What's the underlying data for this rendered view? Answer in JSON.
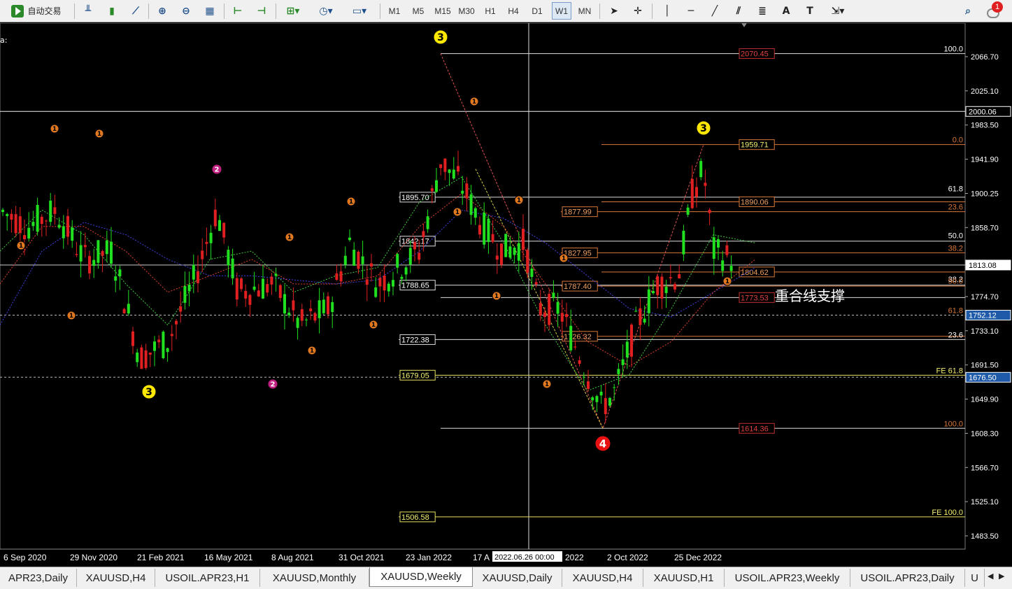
{
  "toolbar": {
    "auto_trade_label": "自动交易",
    "timeframes": [
      "M1",
      "M5",
      "M15",
      "M30",
      "H1",
      "H4",
      "D1",
      "W1",
      "MN"
    ],
    "active_timeframe": "W1",
    "notification_count": "1"
  },
  "chart": {
    "symbol_fragment": "a:",
    "crosshair_time": "2022.06.26 00:00",
    "annotation_text": "重合线支撑",
    "price_axis": [
      "2066.70",
      "2025.10",
      "1983.50",
      "1941.90",
      "1900.25",
      "1858.70",
      "1774.70",
      "1733.10",
      "1691.50",
      "1649.90",
      "1608.30",
      "1566.70",
      "1525.10",
      "1483.50"
    ],
    "price_axis_highlights": [
      {
        "label": "2000.06",
        "color": "#ffffff",
        "bg": "#000000",
        "text": "#ffffff"
      },
      {
        "label": "1813.08",
        "color": "#ffffff",
        "bg": "#ffffff",
        "text": "#000000"
      },
      {
        "label": "1752.12",
        "color": "#ffffff",
        "bg": "#1e5aa8",
        "text": "#ffffff"
      },
      {
        "label": "1676.50",
        "color": "#ffffff",
        "bg": "#1e5aa8",
        "text": "#ffffff"
      }
    ],
    "time_axis": [
      "6 Sep 2020",
      "29 Nov 2020",
      "21 Feb 2021",
      "16 May 2021",
      "8 Aug 2021",
      "31 Oct 2021",
      "23 Jan 2022",
      "17 A",
      "2022",
      "2 Oct 2022",
      "25 Dec 2022"
    ],
    "level_labels_white": [
      "1895.70",
      "1842.17",
      "1788.65",
      "1722.38"
    ],
    "level_labels_yellow": [
      "1679.05",
      "1506.58"
    ],
    "level_labels_orange": [
      "1877.99",
      "1827.95",
      "1787.40",
      "1726.32"
    ],
    "fib_right_labels": [
      "1959.71",
      "1890.06",
      "1804.62"
    ],
    "fib_red_labels": [
      "2070.45",
      "1773.53",
      "1614.36"
    ],
    "fib_pct_labels": [
      "100.0",
      "0.0",
      "61.8",
      "23.6",
      "50.0",
      "38.2",
      "38.2",
      "50.0",
      "61.8",
      "23.6",
      "FE 61.8",
      "100.0",
      "FE 100.0"
    ],
    "wave_labels": [
      {
        "text": "3",
        "kind": "yellow"
      },
      {
        "text": "3",
        "kind": "yellow"
      },
      {
        "text": "3",
        "kind": "yellow"
      },
      {
        "text": "4",
        "kind": "red"
      },
      {
        "text": "2",
        "kind": "magenta"
      },
      {
        "text": "2",
        "kind": "magenta"
      }
    ],
    "minor_wave_label": "1"
  },
  "tabs": [
    "APR23,Daily",
    "XAUUSD,H4",
    "USOIL.APR23,H1",
    "XAUUSD,Monthly",
    "XAUUSD,Weekly",
    "XAUUSD,Daily",
    "XAUUSD,H4",
    "XAUUSD,H1",
    "USOIL.APR23,Weekly",
    "USOIL.APR23,Daily",
    "U"
  ],
  "active_tab": "XAUUSD,Weekly"
}
